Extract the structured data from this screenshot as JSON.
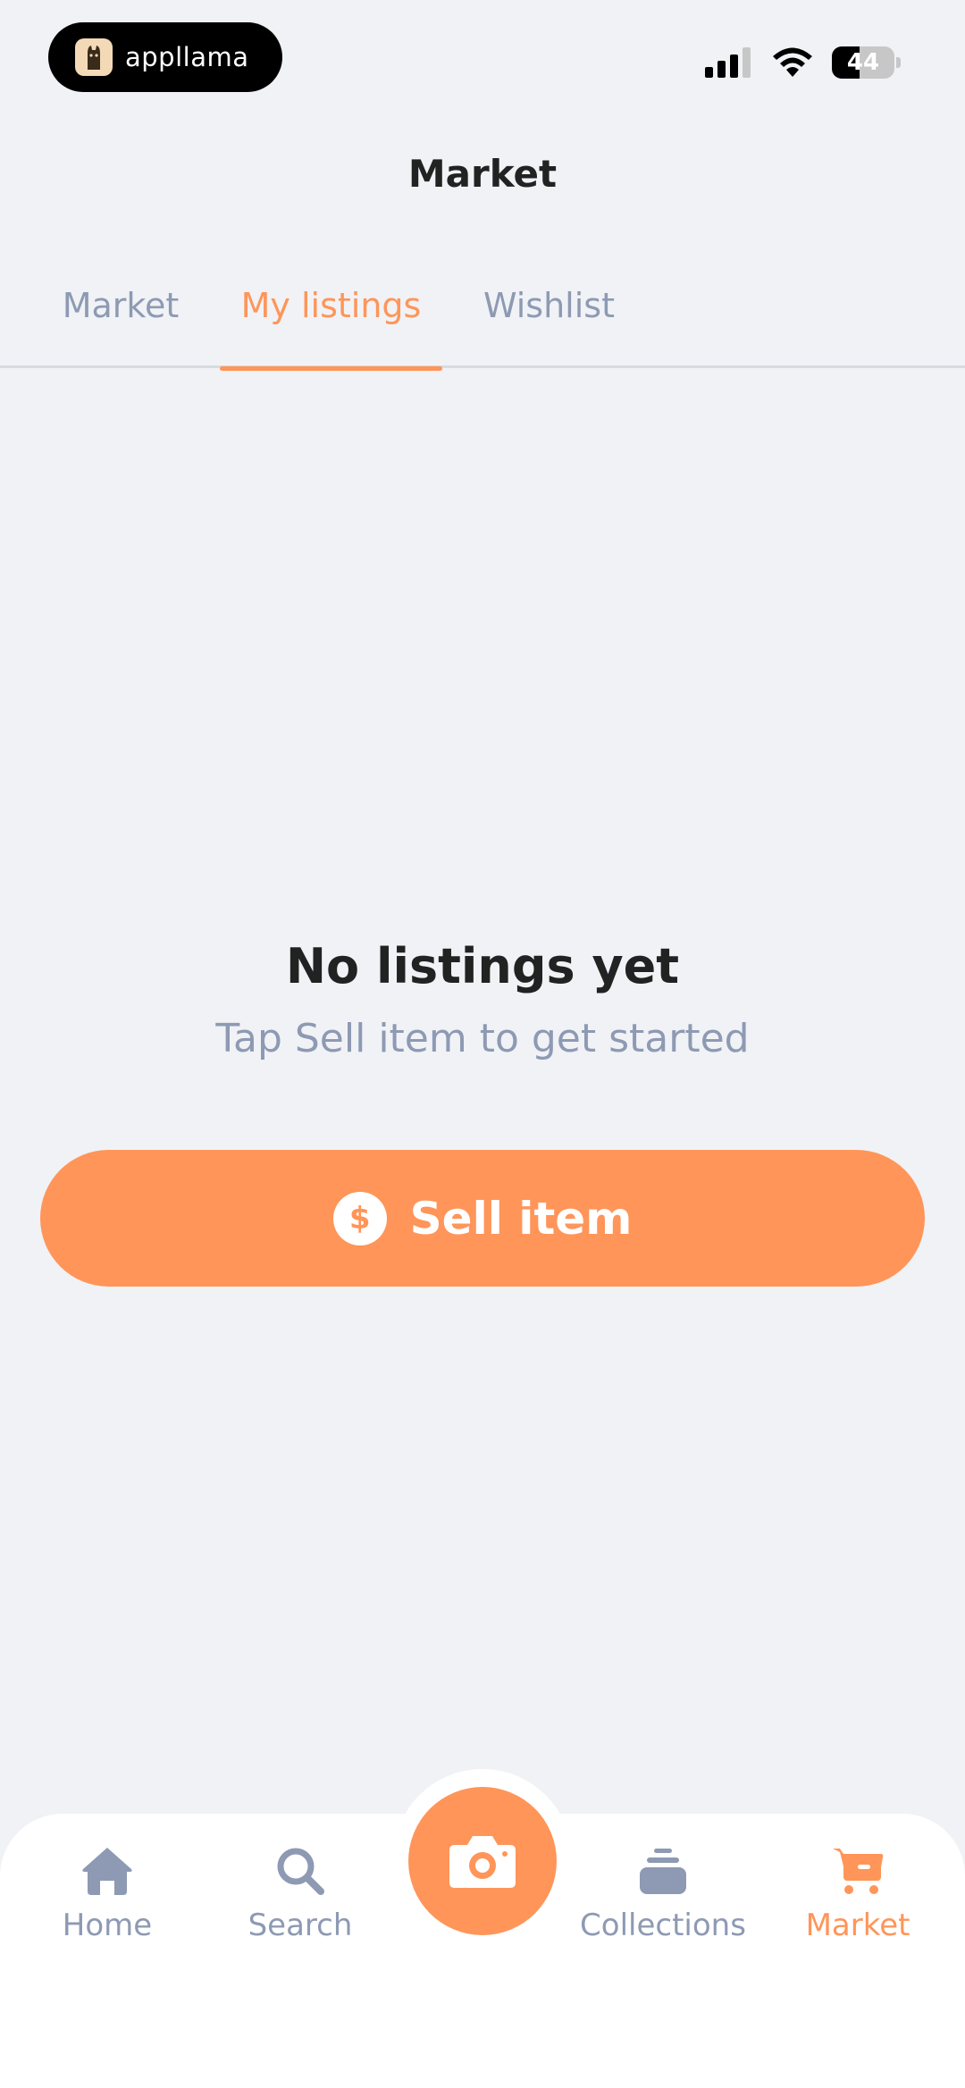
{
  "status_bar": {
    "brand": "appllama",
    "battery": "44",
    "battery_level_fraction": 0.44
  },
  "header": {
    "title": "Market"
  },
  "tabs": [
    {
      "label": "Market",
      "active": false
    },
    {
      "label": "My listings",
      "active": true
    },
    {
      "label": "Wishlist",
      "active": false
    }
  ],
  "empty_state": {
    "title": "No listings yet",
    "subtitle": "Tap Sell item to get started"
  },
  "sell_button": {
    "label": "Sell item",
    "icon": "dollar-icon"
  },
  "bottom_nav": {
    "items": [
      {
        "label": "Home",
        "icon": "home-icon",
        "active": false
      },
      {
        "label": "Search",
        "icon": "search-icon",
        "active": false
      },
      {
        "label": "Collections",
        "icon": "stack-icon",
        "active": false
      },
      {
        "label": "Market",
        "icon": "cart-icon",
        "active": true
      }
    ],
    "camera_icon": "camera-icon"
  },
  "colors": {
    "accent": "#ff9559",
    "muted": "#8e9ab3",
    "background": "#f0f2f6",
    "text": "#222222"
  }
}
